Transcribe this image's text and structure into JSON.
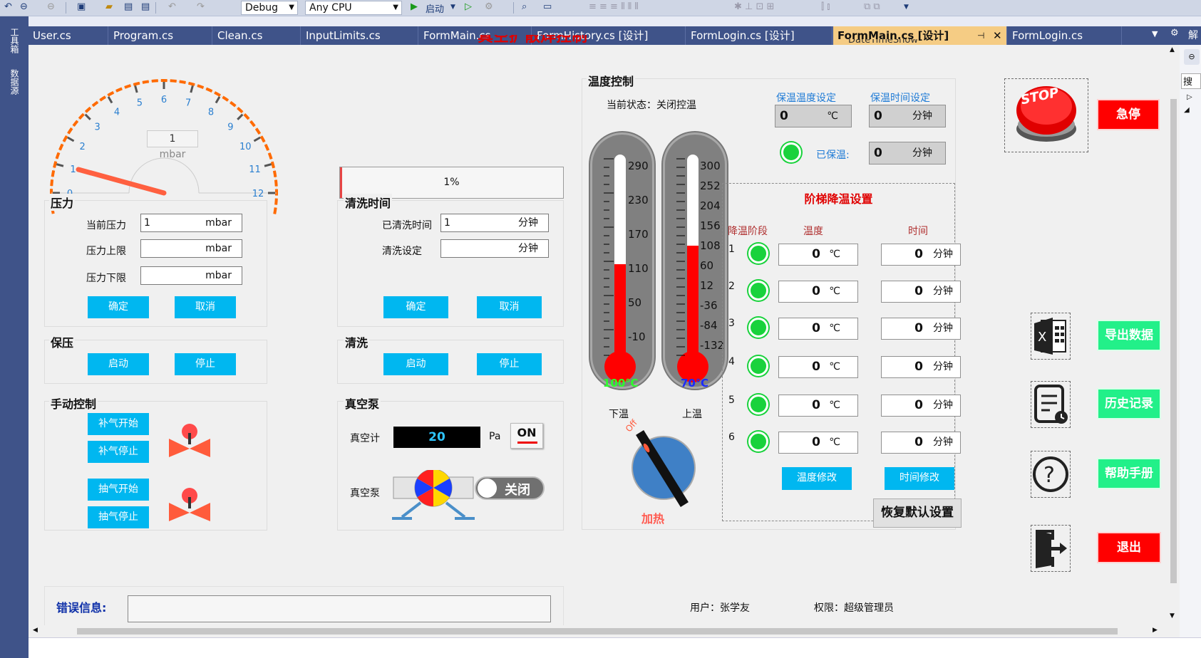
{
  "toolbar": {
    "config": "Debug",
    "platform": "Any CPU",
    "start_label": "启动"
  },
  "side_strip": {
    "toolbox": "工具箱",
    "datasource": "数据源"
  },
  "tabs": [
    {
      "label": "User.cs"
    },
    {
      "label": "Program.cs"
    },
    {
      "label": "Clean.cs"
    },
    {
      "label": "InputLimits.cs"
    },
    {
      "label": "FormMain.cs"
    },
    {
      "label": "FormHistory.cs [设计]"
    },
    {
      "label": "FormLogin.cs [设计]"
    },
    {
      "label": "FormMain.cs [设计]"
    },
    {
      "label": "FormLogin.cs"
    }
  ],
  "right_panel": {
    "title": "解",
    "search": "搜"
  },
  "header": {
    "partial_title": "真空扩散焊控制",
    "datetime": "DateTimeShow"
  },
  "gauge": {
    "value": "1",
    "unit": "mbar",
    "ticks": [
      "0",
      "1",
      "2",
      "3",
      "4",
      "5",
      "6",
      "7",
      "8",
      "9",
      "10",
      "11",
      "12"
    ]
  },
  "pressure": {
    "title": "压力",
    "current_label": "当前压力",
    "current_value": "1",
    "current_unit": "mbar",
    "upper_label": "压力上限",
    "upper_unit": "mbar",
    "lower_label": "压力下限",
    "lower_unit": "mbar",
    "ok": "确定",
    "cancel": "取消"
  },
  "hold_pressure": {
    "title": "保压",
    "start": "启动",
    "stop": "停止"
  },
  "manual": {
    "title": "手动控制",
    "fill_start": "补气开始",
    "fill_stop": "补气停止",
    "pump_start": "抽气开始",
    "pump_stop": "抽气停止"
  },
  "progress": {
    "value": 1,
    "label": "1%"
  },
  "clean_time": {
    "title": "清洗时间",
    "elapsed_label": "已清洗时间",
    "elapsed_value": "1",
    "elapsed_unit": "分钟",
    "set_label": "清洗设定",
    "set_unit": "分钟",
    "ok": "确定",
    "cancel": "取消"
  },
  "clean": {
    "title": "清洗",
    "start": "启动",
    "stop": "停止"
  },
  "vacuum": {
    "title": "真空泵",
    "meter_label": "真空计",
    "meter_value": "20",
    "meter_unit": "Pa",
    "on_label": "ON",
    "pump_label": "真空泵",
    "switch_label": "关闭"
  },
  "temp": {
    "title": "温度控制",
    "status": "当前状态：关闭控温",
    "lower_label": "下温",
    "upper_label": "上温",
    "lower_value": "100℃",
    "upper_value": "70℃",
    "lower_ticks": [
      "290",
      "230",
      "170",
      "110",
      "50",
      "-10"
    ],
    "upper_ticks": [
      "300",
      "252",
      "204",
      "156",
      "108",
      "60",
      "12",
      "-36",
      "-84",
      "-132"
    ],
    "knob_off": "Off",
    "knob_label": "加热",
    "hold_temp_label": "保温温度设定",
    "hold_temp_value": "0",
    "hold_temp_unit": "℃",
    "hold_time_label": "保温时间设定",
    "hold_time_value": "0",
    "hold_time_unit": "分钟",
    "held_label": "已保温:",
    "held_value": "0",
    "held_unit": "分钟"
  },
  "step": {
    "title": "阶梯降温设置",
    "col_stage": "降温阶段",
    "col_temp": "温度",
    "col_time": "时间",
    "rows": [
      {
        "n": "1",
        "temp": "0",
        "tunit": "℃",
        "time": "0",
        "munit": "分钟"
      },
      {
        "n": "2",
        "temp": "0",
        "tunit": "℃",
        "time": "0",
        "munit": "分钟"
      },
      {
        "n": "3",
        "temp": "0",
        "tunit": "℃",
        "time": "0",
        "munit": "分钟"
      },
      {
        "n": "4",
        "temp": "0",
        "tunit": "℃",
        "time": "0",
        "munit": "分钟"
      },
      {
        "n": "5",
        "temp": "0",
        "tunit": "℃",
        "time": "0",
        "munit": "分钟"
      },
      {
        "n": "6",
        "temp": "0",
        "tunit": "℃",
        "time": "0",
        "munit": "分钟"
      }
    ],
    "temp_modify": "温度修改",
    "time_modify": "时间修改",
    "restore": "恢复默认设置"
  },
  "side_buttons": {
    "stop_sign": "STOP",
    "estop": "急停",
    "export": "导出数据",
    "history": "历史记录",
    "help": "帮助手册",
    "exit": "退出"
  },
  "error": {
    "label": "错误信息:"
  },
  "footer": {
    "user": "用户：张学友",
    "role": "权限：超级管理员"
  }
}
